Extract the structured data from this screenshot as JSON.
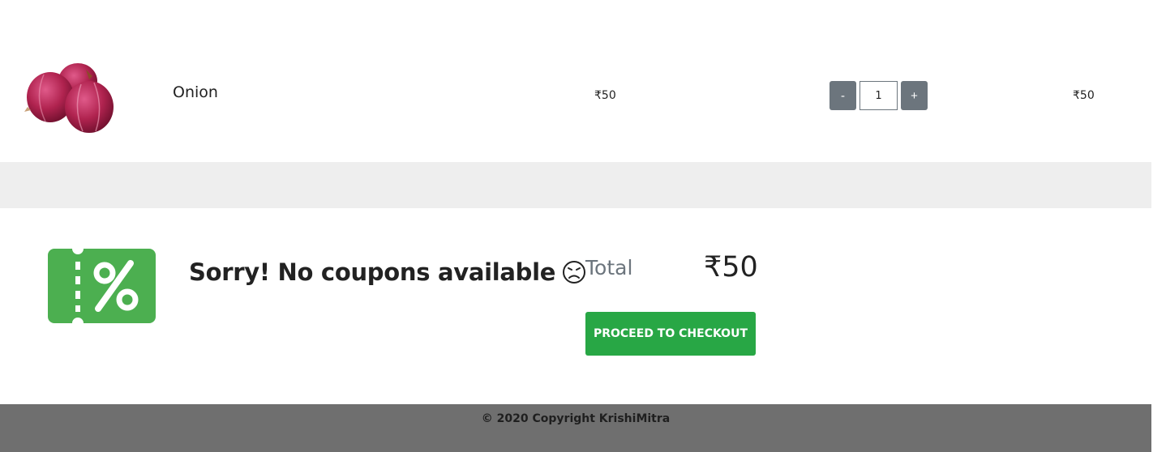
{
  "cart": {
    "item": {
      "name": "Onion",
      "unit_price": "₹50",
      "quantity": "1",
      "line_total": "₹50",
      "image_icon": "onion-image"
    },
    "quantity_controls": {
      "decrement_label": "-",
      "increment_label": "+"
    }
  },
  "coupon": {
    "icon": "coupon-percent-icon",
    "message": "Sorry! No coupons available",
    "emoji_icon": "sad-face-icon"
  },
  "summary": {
    "total_label": "Total",
    "total_value": "₹50",
    "checkout_label": "PROCEED TO CHECKOUT"
  },
  "footer": {
    "copyright": "© 2020 Copyright KrishiMitra"
  },
  "colors": {
    "checkout_green": "#28a745",
    "coupon_green": "#4caf50",
    "qty_button": "#6c757d",
    "band_gray": "#eeeeee",
    "footer_gray": "#6f6f6f"
  }
}
